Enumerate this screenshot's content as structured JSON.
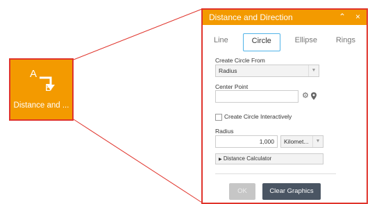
{
  "widget": {
    "icon_top_letter": "A",
    "icon_bottom_letter": "B",
    "label": "Distance and ..."
  },
  "panel": {
    "title": "Distance and Direction",
    "collapse_icon": "⌃",
    "close_icon": "×",
    "tabs": [
      {
        "label": "Line",
        "active": false
      },
      {
        "label": "Circle",
        "active": true
      },
      {
        "label": "Ellipse",
        "active": false
      },
      {
        "label": "Rings",
        "active": false
      }
    ],
    "create_from_label": "Create Circle From",
    "create_from_value": "Radius",
    "center_point_label": "Center Point",
    "center_point_value": "",
    "interactive_label": "Create Circle Interactively",
    "interactive_checked": false,
    "radius_label": "Radius",
    "radius_value": "1,000",
    "unit_value": "Kilomet...",
    "calculator_label": "Distance Calculator",
    "ok_label": "OK",
    "clear_label": "Clear Graphics"
  },
  "colors": {
    "accent": "#f39a00",
    "callout": "#e0332b",
    "tab_active_border": "#4fb3e8",
    "primary_button": "#4a5563"
  }
}
